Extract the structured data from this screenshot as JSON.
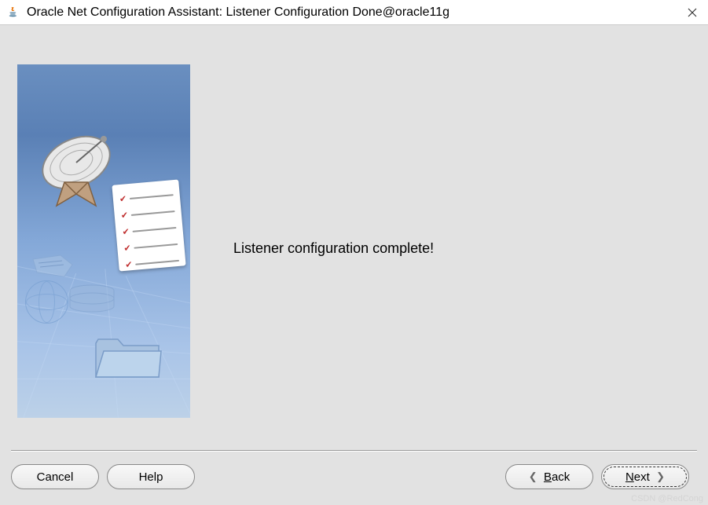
{
  "window": {
    "title": "Oracle Net Configuration Assistant: Listener Configuration Done@oracle11g"
  },
  "main": {
    "message": "Listener configuration complete!"
  },
  "buttons": {
    "cancel": "Cancel",
    "help": "Help",
    "back_prefix": "B",
    "back_rest": "ack",
    "next_prefix": "N",
    "next_rest": "ext"
  },
  "watermark": "CSDN @RedCong"
}
